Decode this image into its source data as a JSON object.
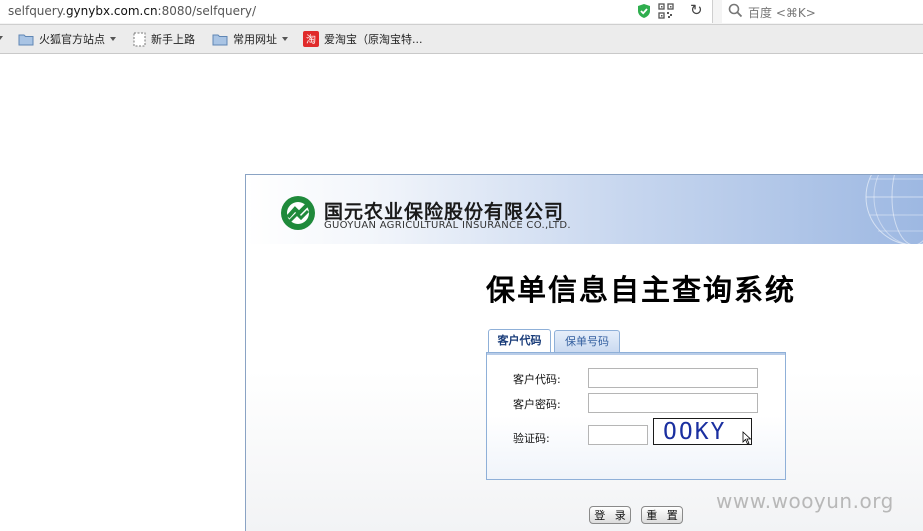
{
  "browser": {
    "url": {
      "prefix": "selfquery.",
      "host": "gynybx.com.cn",
      "suffix": ":8080/selfquery/"
    },
    "search_placeholder": "百度 <⌘K>",
    "bookmarks": [
      {
        "label": "火狐官方站点",
        "icon": "folder-icon",
        "has_menu": true
      },
      {
        "label": "新手上路",
        "icon": "page-icon",
        "has_menu": false
      },
      {
        "label": "常用网址",
        "icon": "folder-icon",
        "has_menu": true
      },
      {
        "label": "爱淘宝（原淘宝特...",
        "icon": "taobao-icon",
        "has_menu": false
      }
    ]
  },
  "page": {
    "company_cn": "国元农业保险股份有限公司",
    "company_en": "GUOYUAN AGRICULTURAL INSURANCE CO.,LTD.",
    "system_title": "保单信息自主查询系统",
    "tabs": [
      {
        "label": "客户代码",
        "active": true
      },
      {
        "label": "保单号码",
        "active": false
      }
    ],
    "form": {
      "customer_code_label": "客户代码:",
      "customer_code_value": "",
      "customer_password_label": "客户密码:",
      "customer_password_value": "",
      "captcha_label": "验证码:",
      "captcha_value": "",
      "captcha_image_text": "OOKY"
    },
    "buttons": {
      "login": "登 录",
      "reset": "重 置"
    }
  },
  "watermark": "www.wooyun.org",
  "colors": {
    "accent_blue": "#8fb0d8",
    "tab_text": "#1a3d7a",
    "logo_green": "#1f8a3b",
    "captcha_text": "#1a2fa0"
  }
}
